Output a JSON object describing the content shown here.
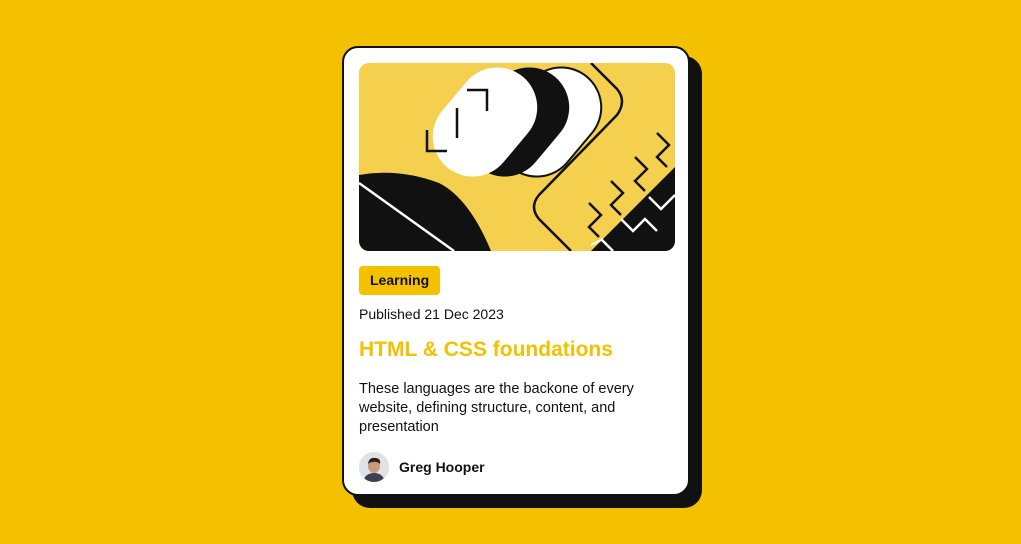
{
  "colors": {
    "page_background": "#F4C100",
    "card_background": "#FFFFFF",
    "ink": "#111111",
    "accent": "#F4C100",
    "hero_yellow": "#F4D04E"
  },
  "card": {
    "tag": "Learning",
    "published": "Published 21 Dec 2023",
    "title": "HTML & CSS foundations",
    "description": "These languages are the backone of every website, defining structure, content, and presentation",
    "author": {
      "name": "Greg Hooper",
      "avatar_icon": "person-portrait"
    },
    "illustration_icon": "abstract-code-illustration"
  }
}
